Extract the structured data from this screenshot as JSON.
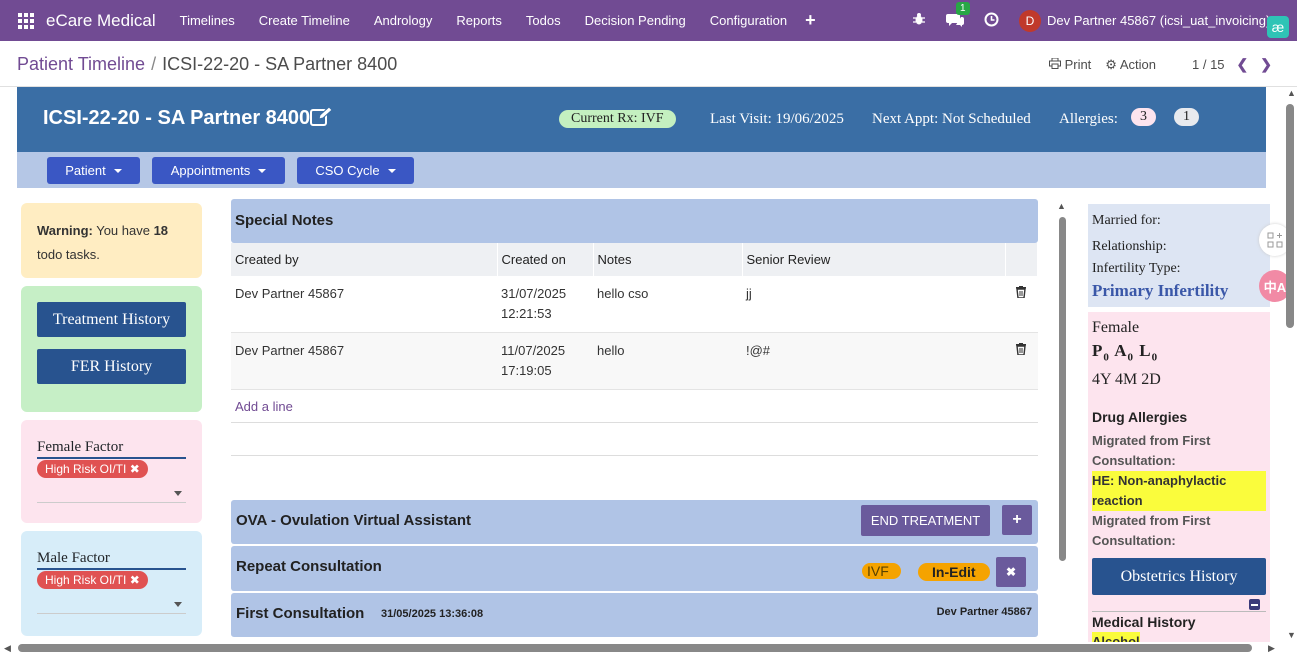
{
  "nav": {
    "brand": "eCare Medical",
    "menu": [
      "Timelines",
      "Create Timeline",
      "Andrology",
      "Reports",
      "Todos",
      "Decision Pending",
      "Configuration"
    ],
    "plus": "+",
    "chat_badge": "1",
    "avatar_letter": "D",
    "user": "Dev Partner 45867 (icsi_uat_invoicing)",
    "ae": "æ"
  },
  "breadcrumb": {
    "root": "Patient Timeline",
    "sep": "/",
    "current": "ICSI-22-20 - SA Partner 8400"
  },
  "pager": {
    "print": "Print",
    "action": "Action",
    "counter": "1 / 15"
  },
  "header": {
    "title": "ICSI-22-20 - SA Partner 8400",
    "rx": "Current Rx: IVF",
    "last_visit": "Last Visit: 19/06/2025",
    "next_appt": "Next Appt: Not Scheduled",
    "allergies_label": "Allergies:",
    "allergy_count1": "3",
    "allergy_count2": "1"
  },
  "subbar": {
    "patient": "Patient",
    "appointments": "Appointments",
    "cso": "CSO Cycle"
  },
  "warning": {
    "bold": "Warning:",
    "text1": " You have ",
    "count": "18",
    "text2": "todo tasks."
  },
  "history": {
    "treatment": "Treatment History",
    "fer": "FER History"
  },
  "female_factor": {
    "label": "Female Factor",
    "tag": "High Risk OI/TI"
  },
  "male_factor": {
    "label": "Male Factor",
    "tag": "High Risk OI/TI"
  },
  "special_notes": {
    "title": "Special Notes",
    "columns": [
      "Created by",
      "Created on",
      "Notes",
      "Senior Review"
    ],
    "rows": [
      {
        "by": "Dev Partner 45867",
        "date": "31/07/2025",
        "time": "12:21:53",
        "notes": "hello cso",
        "review": "jj"
      },
      {
        "by": "Dev Partner 45867",
        "date": "11/07/2025",
        "time": "17:19:05",
        "notes": "hello",
        "review": "!@#"
      }
    ],
    "add_line": "Add a line"
  },
  "ova": {
    "title": "OVA - Ovulation Virtual Assistant",
    "end_btn": "END TREATMENT",
    "plus": "+"
  },
  "repeat": {
    "title": "Repeat Consultation",
    "ivf": "IVF",
    "status": "In-Edit",
    "close": "✖"
  },
  "first": {
    "title": "First Consultation",
    "date": "31/05/2025 13:36:08",
    "doctor": "Dev Partner 45867"
  },
  "right_info": {
    "married_for": "Married for:",
    "relationship": "Relationship:",
    "infertility_type": "Infertility Type:",
    "infertility_value": "Primary Infertility"
  },
  "right_patient": {
    "gender": "Female",
    "pal_p": "P",
    "pal_p0": "0",
    "pal_a": "A",
    "pal_a0": "0",
    "pal_l": "L",
    "pal_l0": "0",
    "age": "4Y 4M 2D",
    "drug_allergies": "Drug Allergies",
    "migrated1": "Migrated from First Consultation:",
    "allergy_hl": "HE: Non-anaphylactic reaction",
    "migrated2": "Migrated from First Consultation:",
    "obstetrics": "Obstetrics History",
    "medical_history": "Medical History",
    "alcohol": "Alcohol"
  },
  "colors": {
    "nav": "#714b93",
    "header": "#3a6ea5",
    "primary_btn": "#28538f"
  }
}
